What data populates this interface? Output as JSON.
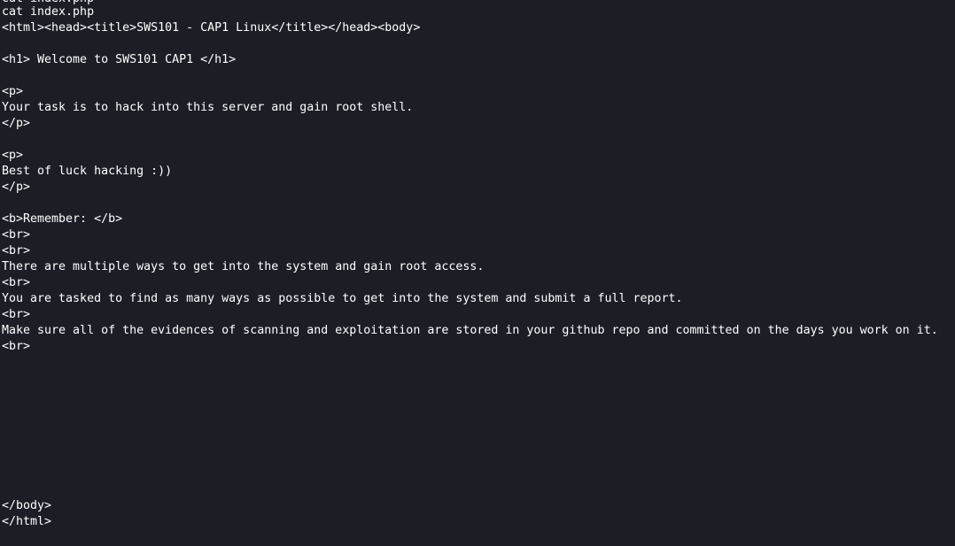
{
  "terminal": {
    "lines": [
      "cat index.php",
      "cat index.php",
      "<html><head><title>SWS101 - CAP1 Linux</title></head><body>",
      "",
      "<h1> Welcome to SWS101 CAP1 </h1>",
      "",
      "<p>",
      "Your task is to hack into this server and gain root shell.",
      "</p>",
      "",
      "<p>",
      "Best of luck hacking :))",
      "</p>",
      "",
      "<b>Remember: </b>",
      "<br>",
      "<br>",
      "There are multiple ways to get into the system and gain root access.",
      "<br>",
      "You are tasked to find as many ways as possible to get into the system and submit a full report.",
      "<br>",
      "Make sure all of the evidences of scanning and exploitation are stored in your github repo and committed on the days you work on it.",
      "<br>",
      "",
      "",
      "",
      "",
      "",
      "",
      "",
      "",
      "",
      "</body>",
      "</html>"
    ]
  }
}
